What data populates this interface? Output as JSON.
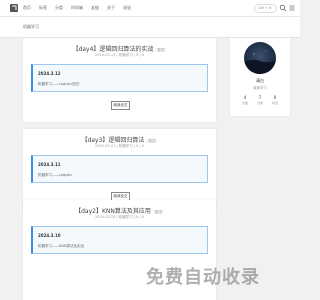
{
  "nav": {
    "items": [
      "首页",
      "标签",
      "分类",
      "时间轴",
      "友链",
      "关于",
      "说说"
    ],
    "search_placeholder": "Ctrl + K"
  },
  "breadcrumb": "机器学习",
  "posts": [
    {
      "title": "【day4】逻辑回归算法的实战",
      "badge": "置顶",
      "meta": "2024-03-13 | 机器学习 | 0 | 0",
      "excerpt_date": "2024.3.12",
      "excerpt_text": "机器学习——Logistic回归",
      "button": "阅读全文"
    },
    {
      "title": "【day3】逻辑回归算法",
      "badge": "置顶",
      "meta": "2024-03-11 | 机器学习 | 0 | 0",
      "excerpt_date": "2024.3.11",
      "excerpt_text": "机器学习——Logistic",
      "button": "阅读全文"
    },
    {
      "title": "【day2】KNN算法及其应用",
      "badge": "置顶",
      "meta": "2024-03-10 | 机器学习 | 0 | 0",
      "excerpt_date": "2024.3.10",
      "excerpt_text": "机器学习——KNN算法及实战",
      "button": "阅读全文"
    }
  ],
  "profile": {
    "name": "清白",
    "subtitle": "清被学习",
    "stats": [
      {
        "value": "4",
        "label": "文章"
      },
      {
        "value": "7",
        "label": "分类"
      },
      {
        "value": "0",
        "label": "标签"
      }
    ]
  },
  "watermark": "免费自动收录",
  "colors": {
    "accent": "#3a8ee6",
    "excerpt_bg": "#f4f9fe"
  }
}
